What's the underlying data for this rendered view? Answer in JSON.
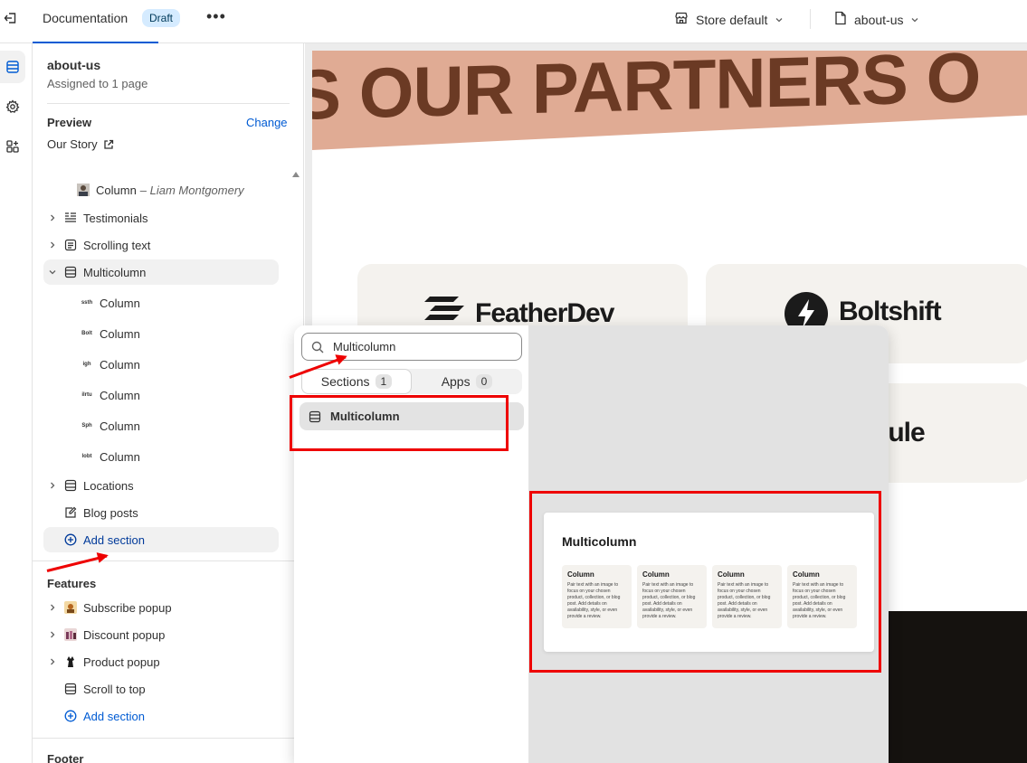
{
  "topbar": {
    "title": "Documentation",
    "status": "Draft",
    "more": "•••",
    "store_selector": "Store default",
    "page_selector": "about-us"
  },
  "sidebar": {
    "template_name": "about-us",
    "assigned": "Assigned to 1 page",
    "preview_label": "Preview",
    "change_label": "Change",
    "preview_page": "Our Story",
    "tree": [
      {
        "label": "Column",
        "suffix": "– Liam Montgomery"
      },
      {
        "label": "Testimonials"
      },
      {
        "label": "Scrolling text"
      },
      {
        "label": "Multicolumn"
      },
      {
        "label": "Column",
        "logo": "ssth"
      },
      {
        "label": "Column",
        "logo": "Bolt"
      },
      {
        "label": "Column",
        "logo": "igh"
      },
      {
        "label": "Column",
        "logo": "ilrtu"
      },
      {
        "label": "Column",
        "logo": "Sph"
      },
      {
        "label": "Column",
        "logo": "lobt"
      },
      {
        "label": "Locations"
      },
      {
        "label": "Blog posts"
      },
      {
        "label": "Add section"
      }
    ],
    "features_label": "Features",
    "features": [
      {
        "label": "Subscribe popup"
      },
      {
        "label": "Discount popup"
      },
      {
        "label": "Product popup"
      },
      {
        "label": "Scroll to top"
      },
      {
        "label": "Add section"
      }
    ],
    "footer_label": "Footer"
  },
  "canvas": {
    "banner_text": "S OUR PARTNERS O",
    "logos": [
      "FeatherDev",
      "Boltshift",
      "erule"
    ]
  },
  "popover": {
    "search_value": "Multicolumn",
    "tabs": [
      {
        "label": "Sections",
        "count": "1"
      },
      {
        "label": "Apps",
        "count": "0"
      }
    ],
    "result_label": "Multicolumn",
    "preview": {
      "title": "Multicolumn",
      "columns": [
        {
          "heading": "Column",
          "text": "Pair text with an image to focus on your chosen product, collection, or blog post. Add details on availability, style, or even provide a review."
        },
        {
          "heading": "Column",
          "text": "Pair text with an image to focus on your chosen product, collection, or blog post. Add details on availability, style, or even provide a review."
        },
        {
          "heading": "Column",
          "text": "Pair text with an image to focus on your chosen product, collection, or blog post. Add details on availability, style, or even provide a review."
        },
        {
          "heading": "Column",
          "text": "Pair text with an image to focus on your chosen product, collection, or blog post. Add details on availability, style, or even provide a review."
        }
      ]
    }
  },
  "colors": {
    "accent": "#005bd3",
    "annotation": "#ee0000",
    "banner": "#e0ab94"
  }
}
